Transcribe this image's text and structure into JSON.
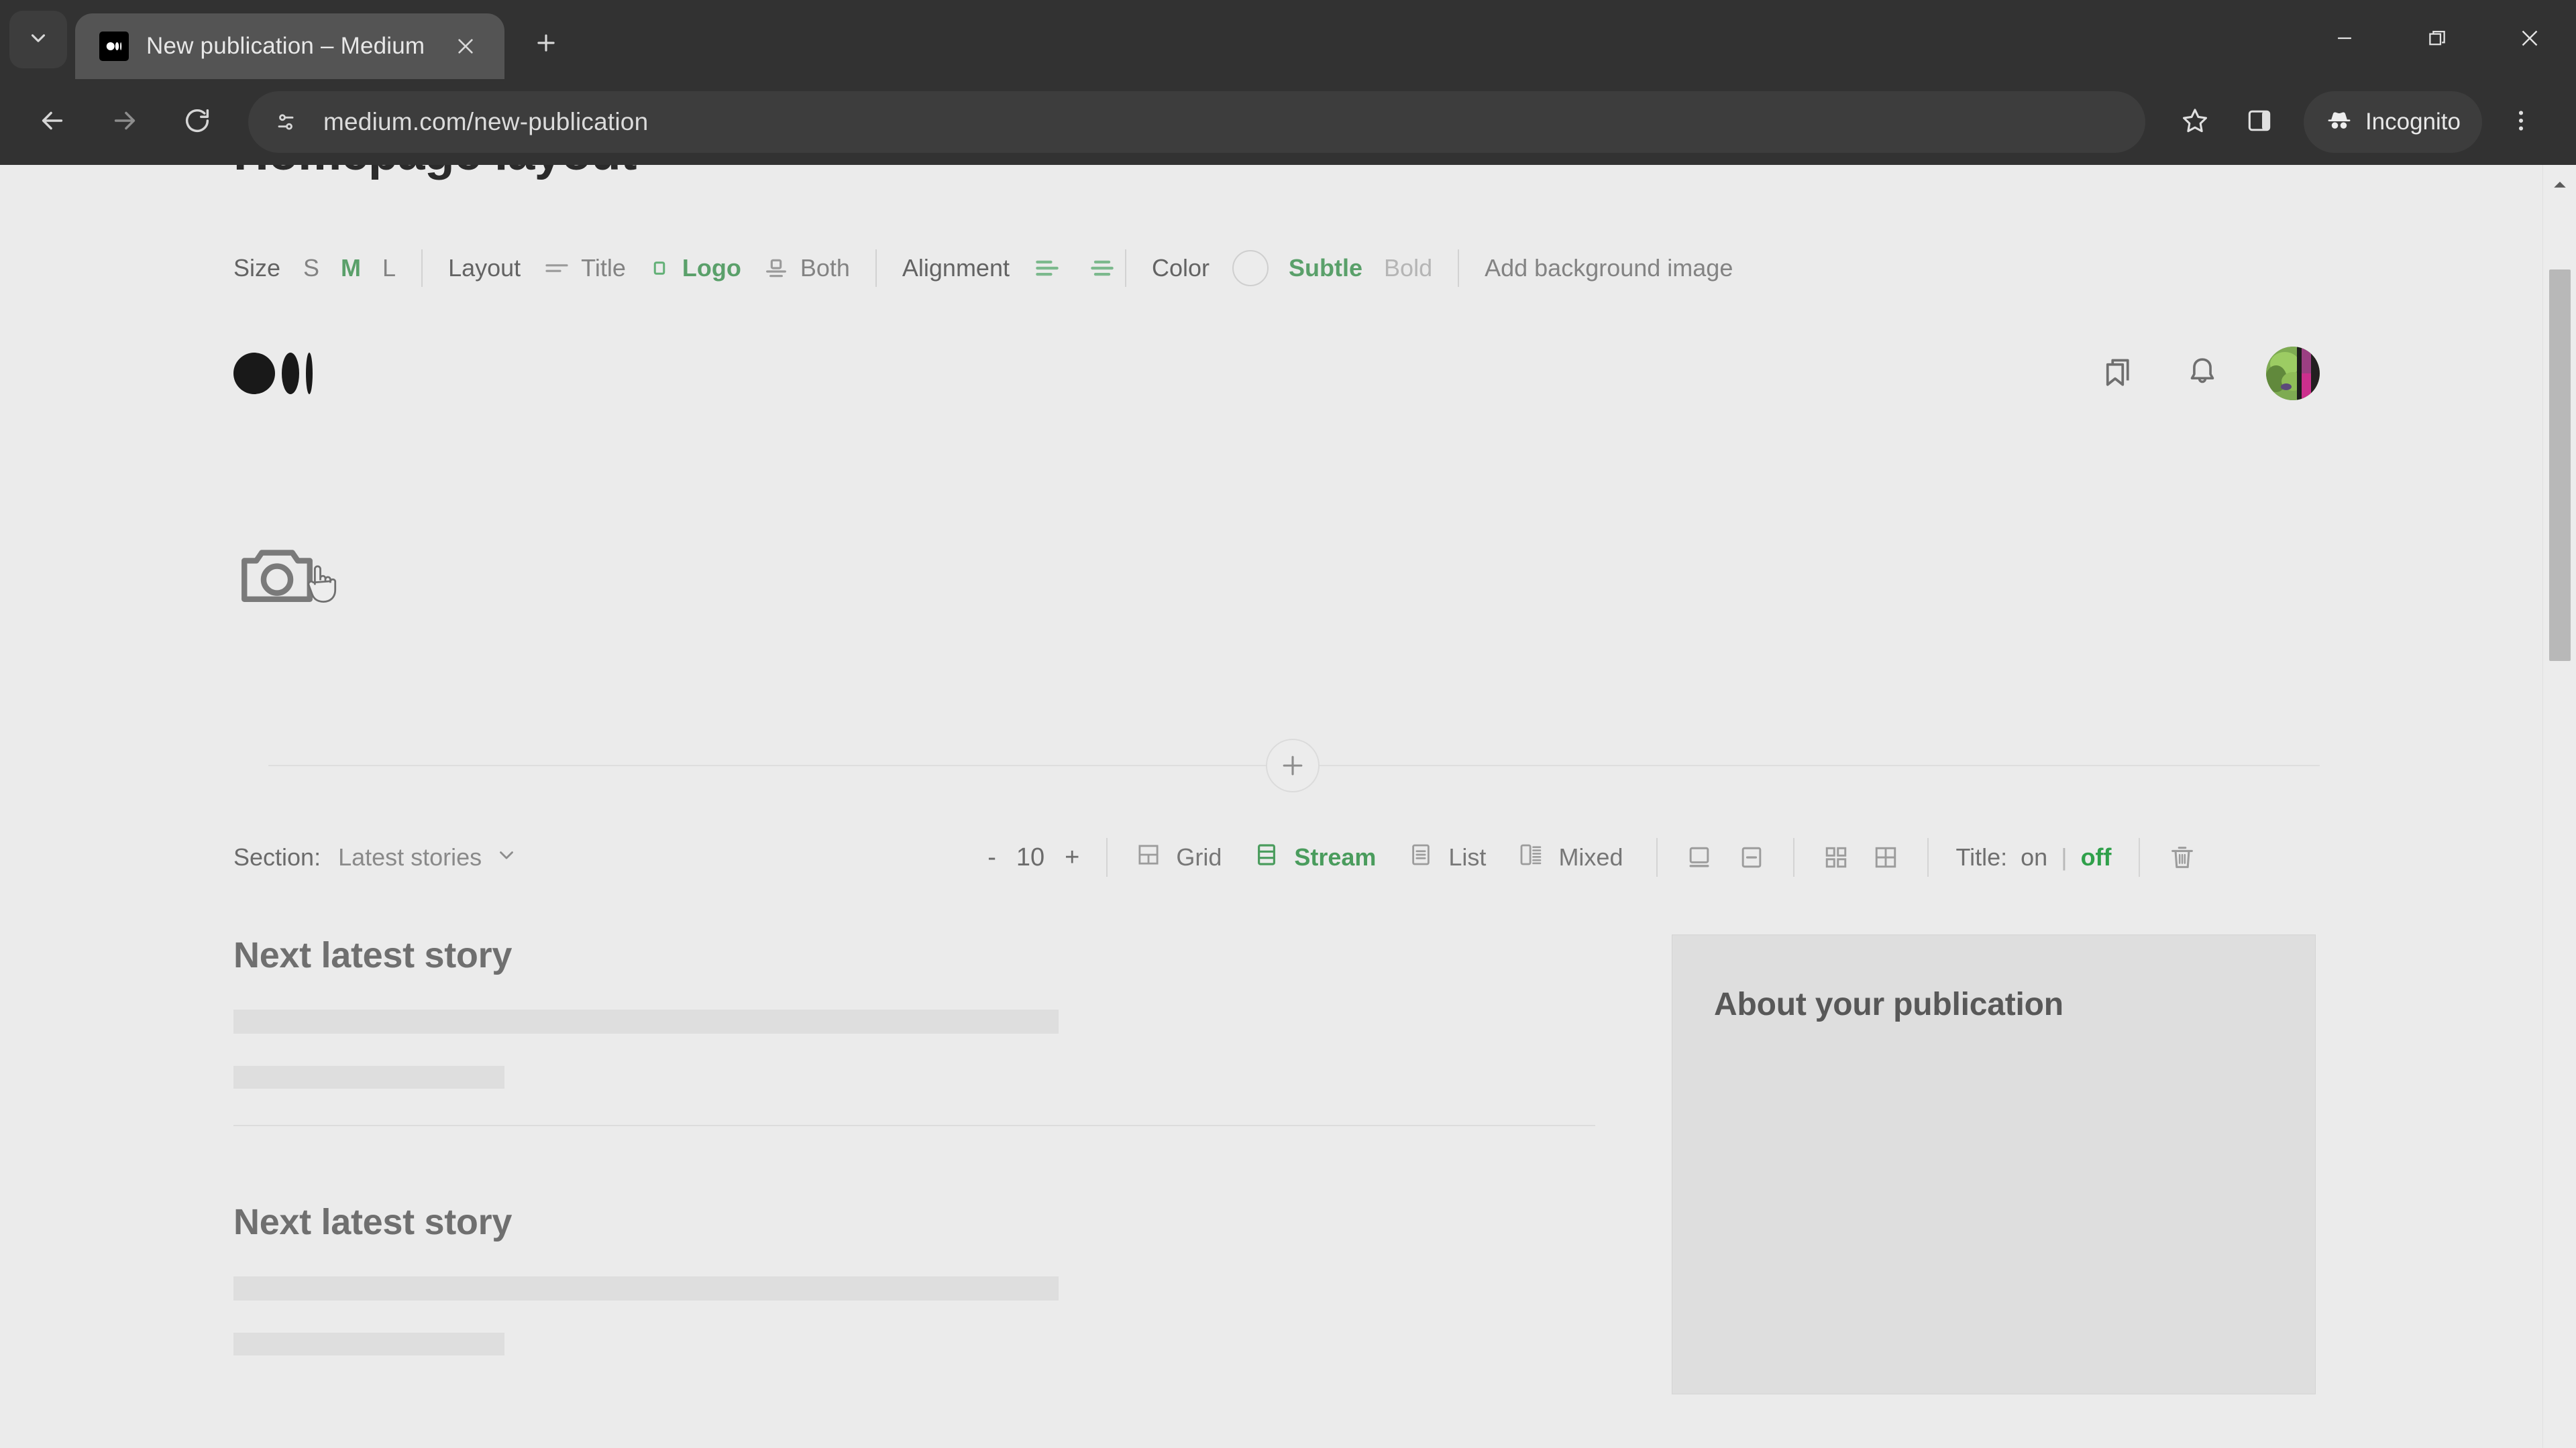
{
  "browser": {
    "tab": {
      "title": "New publication – Medium",
      "favicon": "medium-favicon"
    },
    "url": "medium.com/new-publication",
    "profile_label": "Incognito",
    "icons": {
      "tab_list": "chevron-down-icon",
      "new_tab": "plus-icon",
      "close_tab": "close-icon",
      "back": "back-arrow-icon",
      "forward": "forward-arrow-icon",
      "reload": "reload-icon",
      "site_info": "site-settings-icon",
      "bookmark": "star-icon",
      "side_panel": "side-panel-icon",
      "incognito": "incognito-hat-icon",
      "menu": "three-dot-menu-icon",
      "minimize": "minimize-icon",
      "maximize": "maximize-icon",
      "close_window": "window-close-icon"
    }
  },
  "page": {
    "title": "Homepage layout"
  },
  "header_config": {
    "size": {
      "label": "Size",
      "options": [
        {
          "label": "S",
          "active": false
        },
        {
          "label": "M",
          "active": true
        },
        {
          "label": "L",
          "active": false
        }
      ]
    },
    "layout": {
      "label": "Layout",
      "options": [
        {
          "label": "Title",
          "icon": "lines-icon",
          "active": false
        },
        {
          "label": "Logo",
          "icon": "square-icon",
          "active": true
        },
        {
          "label": "Both",
          "icon": "square-lines-icon",
          "active": false
        }
      ]
    },
    "alignment": {
      "label": "Alignment",
      "options": [
        {
          "icon": "align-left-icon",
          "active": true
        },
        {
          "icon": "align-center-icon",
          "active": true
        }
      ]
    },
    "color": {
      "label": "Color",
      "swatch": "#ececec",
      "options": [
        {
          "label": "Subtle",
          "active": true
        },
        {
          "label": "Bold",
          "active": false,
          "muted": true
        }
      ]
    },
    "background": {
      "label": "Add background image"
    }
  },
  "publication_header": {
    "logo": "medium-logo",
    "icons": [
      {
        "name": "bookmark-lists-icon"
      },
      {
        "name": "notifications-bell-icon"
      },
      {
        "name": "user-avatar"
      }
    ],
    "cover_placeholder": "camera-icon"
  },
  "divider": {
    "add_button": "add-section-plus-icon"
  },
  "section_config": {
    "label": "Section:",
    "value": "Latest stories",
    "count": "10",
    "decrement": "-",
    "increment": "+",
    "view_options": [
      {
        "label": "Grid",
        "icon": "grid-view-icon",
        "active": false
      },
      {
        "label": "Stream",
        "icon": "stream-view-icon",
        "active": true
      },
      {
        "label": "List",
        "icon": "list-view-icon",
        "active": false
      },
      {
        "label": "Mixed",
        "icon": "mixed-view-icon",
        "active": false
      }
    ],
    "image_position": [
      {
        "icon": "image-top-icon"
      },
      {
        "icon": "image-inline-icon"
      }
    ],
    "density": [
      {
        "icon": "grid-small-icon"
      },
      {
        "icon": "grid-large-icon"
      }
    ],
    "title_toggle": {
      "label": "Title:",
      "on": "on",
      "separator": "|",
      "off": "off",
      "selected": "off"
    },
    "delete": "trash-icon"
  },
  "stories": [
    {
      "title": "Next latest story"
    },
    {
      "title": "Next latest story"
    }
  ],
  "aside": {
    "title": "About your publication"
  },
  "colors": {
    "accent_green": "#4a9c5d",
    "page_bg": "#ebebeb",
    "chrome_bg": "#323232",
    "muted_text": "#838383"
  }
}
